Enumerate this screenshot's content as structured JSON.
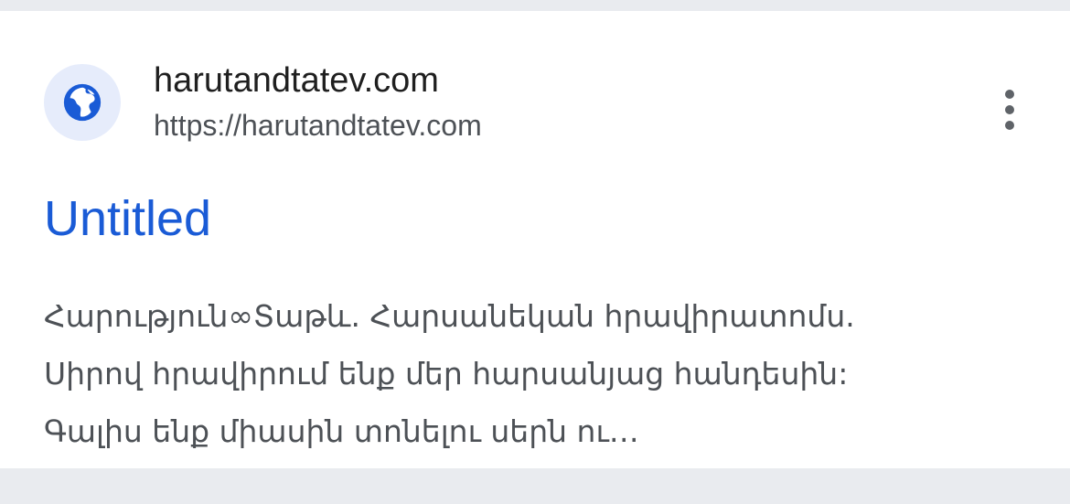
{
  "result": {
    "site_name": "harutandtatev.com",
    "url": "https://harutandtatev.com",
    "title": "Untitled",
    "snippet_lines": [
      "Հարություն∞Տաթև. Հարսանեկան հրավիրատոմս.",
      "Սիրով հրավիրում ենք մեր հարսանյաց հանդեսին:",
      "Գալիս ենք միասին տոնելու սերն ու…"
    ],
    "favicon_icon": "globe-icon",
    "menu_icon": "more-vert-icon"
  },
  "colors": {
    "title_link": "#1a5bd6",
    "snippet_text": "#4d5156",
    "favicon_bg": "#e6ecfb",
    "favicon_fg": "#1a5bd6",
    "page_bg": "#e9ebef"
  }
}
